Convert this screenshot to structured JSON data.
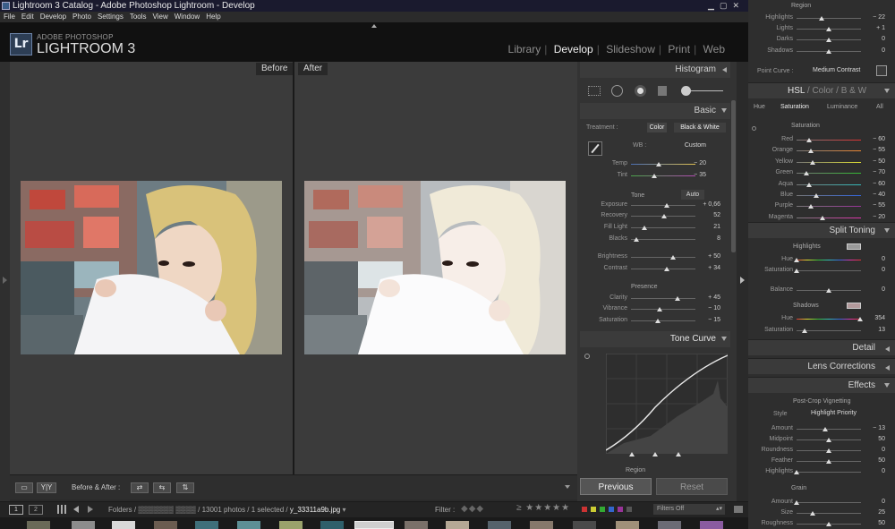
{
  "window": {
    "title": "Lightroom 3 Catalog - Adobe Photoshop Lightroom - Develop"
  },
  "menu": [
    "File",
    "Edit",
    "Develop",
    "Photo",
    "Settings",
    "Tools",
    "View",
    "Window",
    "Help"
  ],
  "brand": {
    "logo": "Lr",
    "line1": "ADOBE PHOTOSHOP",
    "line2": "LIGHTROOM 3"
  },
  "modules": [
    "Library",
    "Develop",
    "Slideshow",
    "Print",
    "Web"
  ],
  "active_module": "Develop",
  "view": {
    "before_label": "Before",
    "after_label": "After"
  },
  "toolbar": {
    "yy": "Y|Y",
    "before_after": "Before & After :"
  },
  "histogram": {
    "title": "Histogram"
  },
  "basic": {
    "title": "Basic",
    "treatment_label": "Treatment :",
    "color": "Color",
    "bw": "Black & White",
    "wb_label": "WB :",
    "wb_value": "Custom",
    "temp": {
      "label": "Temp",
      "value": "− 20",
      "level": 0.43
    },
    "tint": {
      "label": "Tint",
      "value": "− 35",
      "level": 0.36
    },
    "tone_label": "Tone",
    "auto": "Auto",
    "exposure": {
      "label": "Exposure",
      "value": "+ 0,66",
      "level": 0.55
    },
    "recovery": {
      "label": "Recovery",
      "value": "52",
      "level": 0.52
    },
    "fill": {
      "label": "Fill Light",
      "value": "21",
      "level": 0.21
    },
    "blacks": {
      "label": "Blacks",
      "value": "8",
      "level": 0.08
    },
    "brightness": {
      "label": "Brightness",
      "value": "+ 50",
      "level": 0.65
    },
    "contrast": {
      "label": "Contrast",
      "value": "+ 34",
      "level": 0.56
    },
    "presence_label": "Presence",
    "clarity": {
      "label": "Clarity",
      "value": "+ 45",
      "level": 0.72
    },
    "vibrance": {
      "label": "Vibrance",
      "value": "− 10",
      "level": 0.45
    },
    "saturation": {
      "label": "Saturation",
      "value": "− 15",
      "level": 0.42
    }
  },
  "tonecurve": {
    "title": "Tone Curve",
    "region": "Region"
  },
  "buttons": {
    "previous": "Previous",
    "reset": "Reset"
  },
  "right": {
    "region_label": "Region",
    "highlights": {
      "label": "Highlights",
      "value": "− 22",
      "level": 0.39
    },
    "lights": {
      "label": "Lights",
      "value": "+ 1",
      "level": 0.5
    },
    "darks": {
      "label": "Darks",
      "value": "0",
      "level": 0.5
    },
    "shadows": {
      "label": "Shadows",
      "value": "0",
      "level": 0.5
    },
    "point_curve_label": "Point Curve :",
    "point_curve_value": "Medium Contrast",
    "hsl": "HSL",
    "color": "Color",
    "bw": "B & W",
    "tabs": [
      "Hue",
      "Saturation",
      "Luminance",
      "All"
    ],
    "sat_title": "Saturation",
    "colors": [
      {
        "label": "Red",
        "value": "− 60",
        "level": 0.2
      },
      {
        "label": "Orange",
        "value": "− 55",
        "level": 0.22
      },
      {
        "label": "Yellow",
        "value": "− 50",
        "level": 0.25
      },
      {
        "label": "Green",
        "value": "− 70",
        "level": 0.15
      },
      {
        "label": "Aqua",
        "value": "− 60",
        "level": 0.2
      },
      {
        "label": "Blue",
        "value": "− 40",
        "level": 0.3
      },
      {
        "label": "Purple",
        "value": "− 55",
        "level": 0.22
      },
      {
        "label": "Magenta",
        "value": "− 20",
        "level": 0.4
      }
    ],
    "split_toning": "Split Toning",
    "st_highlights": "Highlights",
    "st_hue": {
      "label": "Hue",
      "value": "0",
      "level": 0
    },
    "st_sat": {
      "label": "Saturation",
      "value": "0",
      "level": 0
    },
    "balance": {
      "label": "Balance",
      "value": "0",
      "level": 0.5
    },
    "st_shadows": "Shadows",
    "sh_hue": {
      "label": "Hue",
      "value": "354",
      "level": 0.98
    },
    "sh_sat": {
      "label": "Saturation",
      "value": "13",
      "level": 0.13
    },
    "detail": "Detail",
    "lens": "Lens Corrections",
    "effects": "Effects",
    "vignette_title": "Post-Crop Vignetting",
    "style_label": "Style",
    "style_value": "Highlight Priority",
    "amount": {
      "label": "Amount",
      "value": "− 13",
      "level": 0.44
    },
    "midpoint": {
      "label": "Midpoint",
      "value": "50",
      "level": 0.5
    },
    "roundness": {
      "label": "Roundness",
      "value": "0",
      "level": 0.5
    },
    "feather": {
      "label": "Feather",
      "value": "50",
      "level": 0.5
    },
    "vhighlights": {
      "label": "Highlights",
      "value": "0",
      "level": 0
    },
    "grain_title": "Grain",
    "g_amount": {
      "label": "Amount",
      "value": "0",
      "level": 0
    },
    "g_size": {
      "label": "Size",
      "value": "25",
      "level": 0.25
    },
    "g_rough": {
      "label": "Roughness",
      "value": "50",
      "level": 0.5
    }
  },
  "filmbar": {
    "one": "1",
    "two": "2",
    "path": "Folders / ▒▒▒▒▒▒▒ ▒▒▒▒ / 13001 photos / 1 selected /",
    "file": "y_33311a9b.jpg",
    "filter": "Filter :",
    "filters_off": "Filters Off"
  },
  "colors": {
    "accent": "#3b5d8a"
  }
}
